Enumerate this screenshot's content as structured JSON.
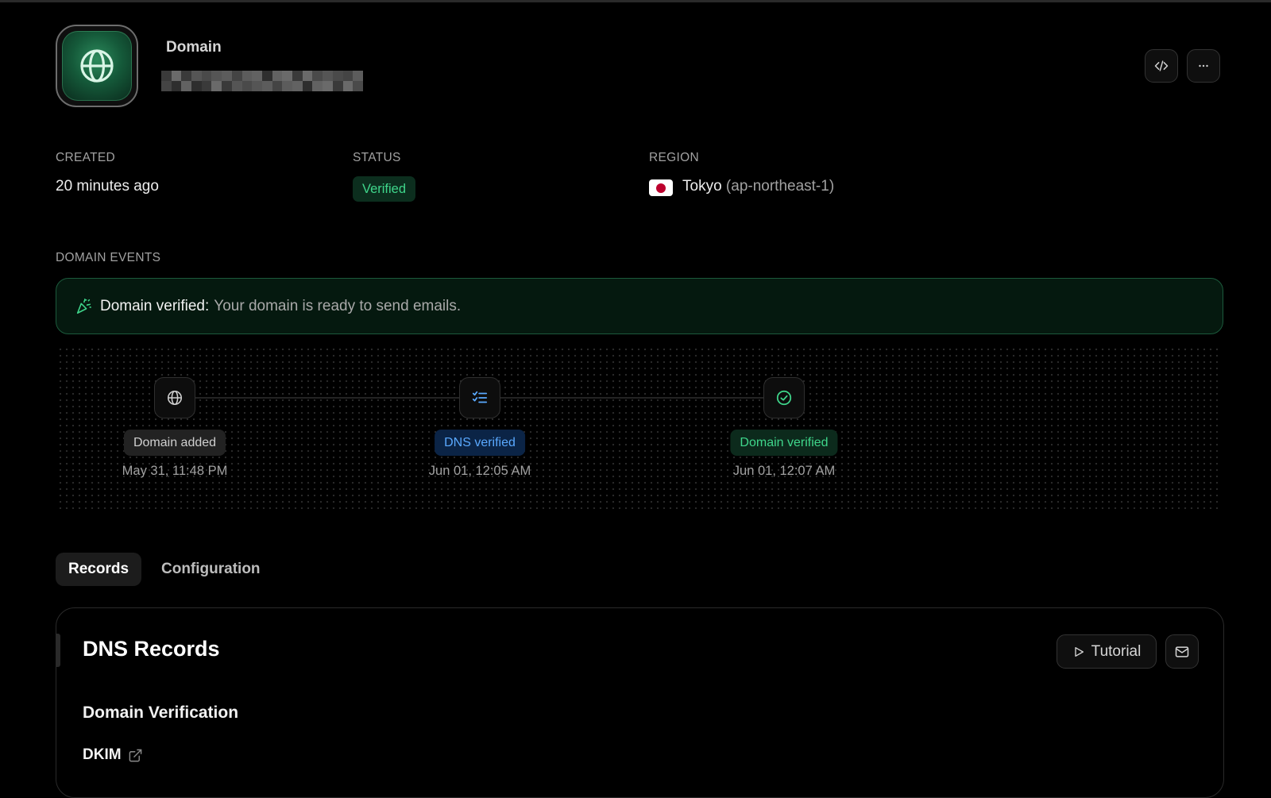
{
  "header": {
    "kind": "Domain",
    "actions": [
      {
        "name": "code-view",
        "icon": "code-icon"
      },
      {
        "name": "more",
        "icon": "more-horizontal-icon"
      }
    ]
  },
  "meta": {
    "created": {
      "label": "CREATED",
      "value": "20 minutes ago"
    },
    "status": {
      "label": "STATUS",
      "value": "Verified"
    },
    "region": {
      "label": "REGION",
      "city": "Tokyo",
      "code": "(ap-northeast-1)",
      "flag": "japan-flag-icon"
    }
  },
  "events": {
    "label": "DOMAIN EVENTS",
    "banner": {
      "title": "Domain verified:",
      "message": "Your domain is ready to send emails.",
      "icon": "party-popper-icon"
    },
    "steps": [
      {
        "label": "Domain added",
        "time": "May 31, 11:48 PM",
        "icon": "globe-icon",
        "tone": "gray"
      },
      {
        "label": "DNS verified",
        "time": "Jun 01, 12:05 AM",
        "icon": "checklist-icon",
        "tone": "blue"
      },
      {
        "label": "Domain verified",
        "time": "Jun 01, 12:07 AM",
        "icon": "check-circle-icon",
        "tone": "green"
      }
    ]
  },
  "tabs": [
    {
      "label": "Records",
      "active": true
    },
    {
      "label": "Configuration",
      "active": false
    }
  ],
  "records": {
    "title": "DNS Records",
    "tutorial_label": "Tutorial",
    "section_title": "Domain Verification",
    "dkim_label": "DKIM"
  },
  "colors": {
    "accent_green": "#3fd68b",
    "accent_blue": "#5aa9ff",
    "background": "#000000"
  }
}
